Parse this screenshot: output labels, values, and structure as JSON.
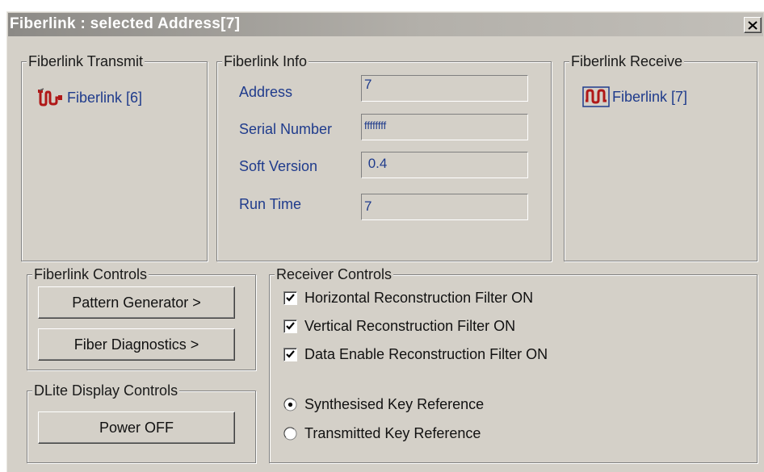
{
  "window": {
    "title": "Fiberlink : selected Address[7]",
    "close_glyph": "✕"
  },
  "transmit": {
    "title": "Fiberlink Transmit",
    "link_label": "Fiberlink [6]",
    "icon": "fiberlink-icon"
  },
  "info": {
    "title": "Fiberlink Info",
    "fields": [
      {
        "label": "Address",
        "value": "7"
      },
      {
        "label": "Serial Number",
        "value": "ffffffff"
      },
      {
        "label": "Soft Version",
        "value": " 0.4"
      },
      {
        "label": "Run Time",
        "value": "7"
      }
    ]
  },
  "receive": {
    "title": "Fiberlink Receive",
    "link_label": "Fiberlink [7]",
    "icon": "fiberlink-icon"
  },
  "controls": {
    "title": "Fiberlink Controls",
    "pattern_generator_label": "Pattern Generator >",
    "fiber_diagnostics_label": "Fiber Diagnostics >"
  },
  "dlite": {
    "title": "DLite Display Controls",
    "power_label": "Power OFF"
  },
  "receiver": {
    "title": "Receiver Controls",
    "checkboxes": [
      {
        "label": "Horizontal Reconstruction Filter ON",
        "checked": true
      },
      {
        "label": "Vertical Reconstruction Filter ON",
        "checked": true
      },
      {
        "label": "Data Enable Reconstruction Filter ON",
        "checked": true
      }
    ],
    "radios": [
      {
        "label": "Synthesised Key Reference",
        "selected": true
      },
      {
        "label": "Transmitted Key Reference",
        "selected": false
      }
    ]
  },
  "colors": {
    "face": "#d4d0c8",
    "link_text": "#1f3b8c",
    "icon_red": "#b01818"
  }
}
